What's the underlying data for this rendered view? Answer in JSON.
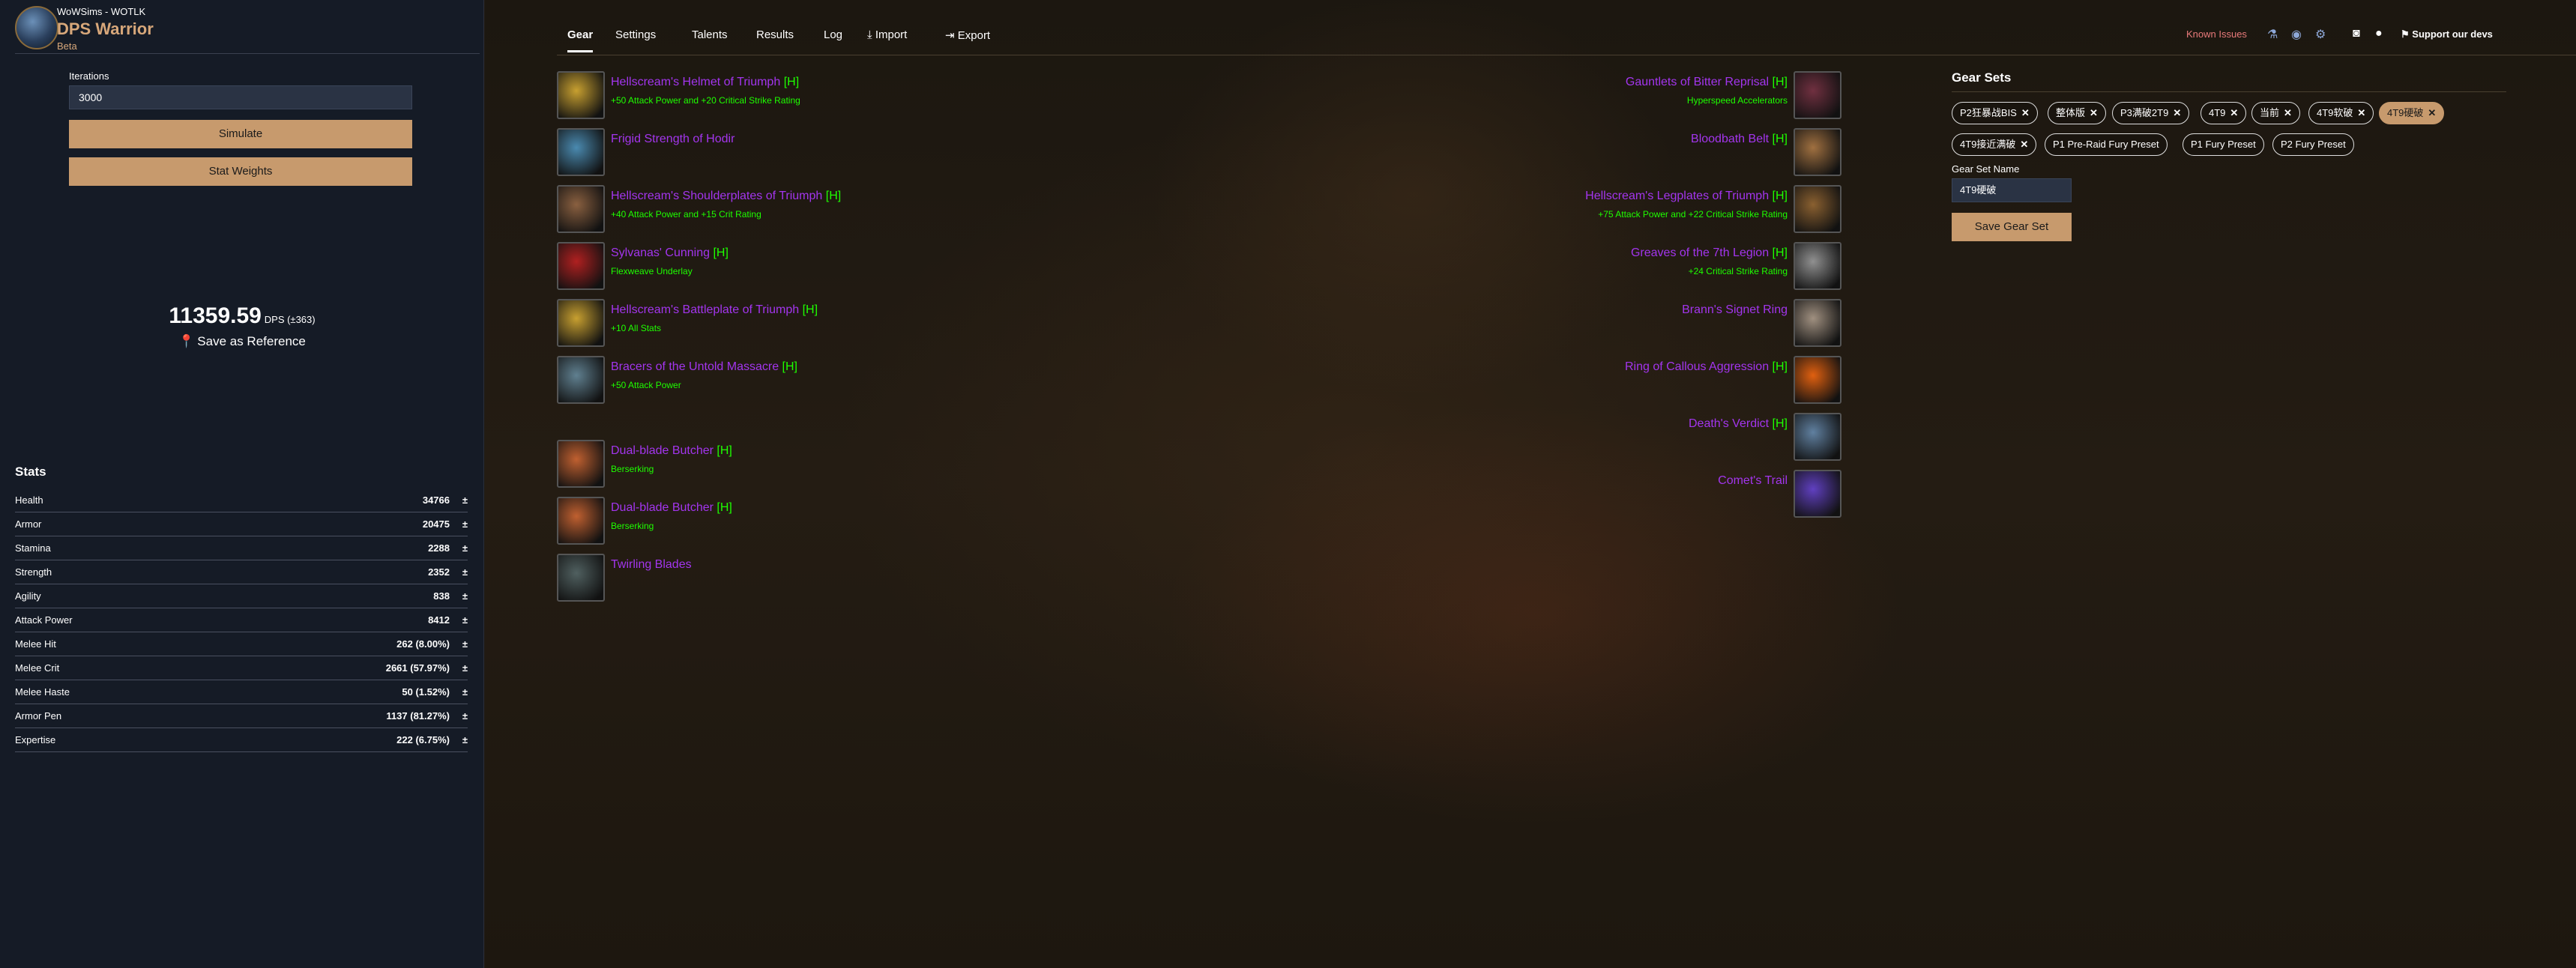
{
  "brand": {
    "subtitle": "WoWSims - WOTLK",
    "title": "DPS Warrior",
    "badge": "Beta"
  },
  "sidebar": {
    "iterations_label": "Iterations",
    "iterations_value": "3000",
    "simulate_label": "Simulate",
    "stat_weights_label": "Stat Weights",
    "dps_value": "11359.59",
    "dps_unit": "DPS (±363)",
    "save_reference_label": "Save as Reference",
    "stats_title": "Stats",
    "stats": [
      {
        "name": "Health",
        "value": "34766"
      },
      {
        "name": "Armor",
        "value": "20475"
      },
      {
        "name": "Stamina",
        "value": "2288"
      },
      {
        "name": "Strength",
        "value": "2352"
      },
      {
        "name": "Agility",
        "value": "838"
      },
      {
        "name": "Attack Power",
        "value": "8412"
      },
      {
        "name": "Melee Hit",
        "value": "262 (8.00%)"
      },
      {
        "name": "Melee Crit",
        "value": "2661 (57.97%)"
      },
      {
        "name": "Melee Haste",
        "value": "50 (1.52%)"
      },
      {
        "name": "Armor Pen",
        "value": "1137 (81.27%)"
      },
      {
        "name": "Expertise",
        "value": "222 (6.75%)"
      }
    ],
    "stat_dl_glyph": "±"
  },
  "tabs": [
    {
      "label": "Gear"
    },
    {
      "label": "Settings"
    },
    {
      "label": "Talents"
    },
    {
      "label": "Results"
    },
    {
      "label": "Log"
    },
    {
      "label": "Import"
    },
    {
      "label": "Export"
    }
  ],
  "header": {
    "known_issues": "Known Issues",
    "support": "Support our devs"
  },
  "gear_left": [
    {
      "name": "Hellscream's Helmet of Triumph",
      "heroic": "[H]",
      "enchant": "+50 Attack Power and +20 Critical Strike Rating",
      "color": "#c8a030"
    },
    {
      "name": "Frigid Strength of Hodir",
      "heroic": "",
      "enchant": "",
      "color": "#4a8ab0"
    },
    {
      "name": "Hellscream's Shoulderplates of Triumph",
      "heroic": "[H]",
      "enchant": "+40 Attack Power and +15 Crit Rating",
      "color": "#8a6040"
    },
    {
      "name": "Sylvanas' Cunning",
      "heroic": "[H]",
      "enchant": "Flexweave Underlay",
      "color": "#b02020"
    },
    {
      "name": "Hellscream's Battleplate of Triumph",
      "heroic": "[H]",
      "enchant": "+10 All Stats",
      "color": "#c8a030"
    },
    {
      "name": "Bracers of the Untold Massacre",
      "heroic": "[H]",
      "enchant": "+50 Attack Power",
      "color": "#608090"
    },
    {
      "name": "Dual-blade Butcher",
      "heroic": "[H]",
      "enchant": "Berserking",
      "color": "#c06030"
    },
    {
      "name": "Dual-blade Butcher",
      "heroic": "[H]",
      "enchant": "Berserking",
      "color": "#c06030"
    },
    {
      "name": "Twirling Blades",
      "heroic": "",
      "enchant": "",
      "color": "#506060"
    }
  ],
  "gear_right": [
    {
      "name": "Gauntlets of Bitter Reprisal",
      "heroic": "[H]",
      "enchant": "Hyperspeed Accelerators",
      "color": "#703040"
    },
    {
      "name": "Bloodbath Belt",
      "heroic": "[H]",
      "enchant": "",
      "color": "#a07040"
    },
    {
      "name": "Hellscream's Legplates of Triumph",
      "heroic": "[H]",
      "enchant": "+75 Attack Power and +22 Critical Strike Rating",
      "color": "#8a6030"
    },
    {
      "name": "Greaves of the 7th Legion",
      "heroic": "[H]",
      "enchant": "+24 Critical Strike Rating",
      "color": "#909090"
    },
    {
      "name": "Brann's Signet Ring",
      "heroic": "",
      "enchant": "",
      "color": "#a09080"
    },
    {
      "name": "Ring of Callous Aggression",
      "heroic": "[H]",
      "enchant": "",
      "color": "#e06010"
    },
    {
      "name": "Death's Verdict",
      "heroic": "[H]",
      "enchant": "",
      "color": "#6080a0"
    },
    {
      "name": "Comet's Trail",
      "heroic": "",
      "enchant": "",
      "color": "#6040c0"
    }
  ],
  "gear_sets": {
    "title": "Gear Sets",
    "chips": [
      {
        "label": "P2狂暴战BIS"
      },
      {
        "label": "整体版"
      },
      {
        "label": "P3满破2T9"
      },
      {
        "label": "4T9"
      },
      {
        "label": "当前"
      },
      {
        "label": "4T9软破"
      },
      {
        "label": "4T9硬破"
      },
      {
        "label": "4T9接近满破"
      },
      {
        "label": "P1 Pre-Raid Fury Preset"
      },
      {
        "label": "P1 Fury Preset"
      },
      {
        "label": "P2 Fury Preset"
      }
    ],
    "name_label": "Gear Set Name",
    "name_value": "4T9硬破",
    "save_label": "Save Gear Set"
  }
}
